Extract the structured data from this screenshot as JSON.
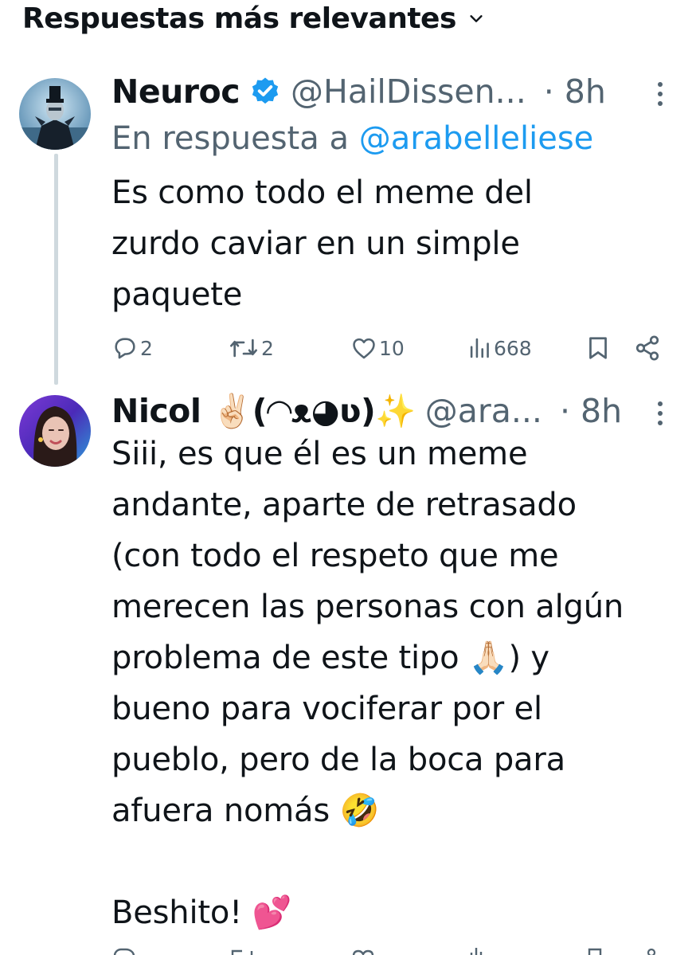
{
  "sort": {
    "label": "Respuestas más relevantes"
  },
  "tweets": [
    {
      "display_name": "Neuroc",
      "handle": "@HailDissen...",
      "time": "· 8h",
      "reply_prefix": "En respuesta a ",
      "reply_mention": "@arabelleliese",
      "text": "Es como todo el meme del\nzurdo caviar en un simple\npaquete",
      "replies": "2",
      "retweets": "2",
      "likes": "10",
      "views": "668"
    },
    {
      "display_name": "Nicol ✌🏻(◠ᴥ◕ʋ)✨",
      "handle": "@ara...",
      "time": "· 8h",
      "text": "Siii, es que él es un meme\nandante, aparte de retrasado\n(con todo el respeto que me\nmerecen las personas con algún\nproblema de este tipo 🙏🏻) y\nbueno para vociferar por el\npueblo, pero de la boca para\nafuera nomás 🤣\n\nBeshito! 💕"
    }
  ],
  "colors": {
    "accent": "#1d9bf0",
    "secondary_text": "#536471",
    "primary_text": "#0f1419",
    "thread_line": "#cfd9de"
  }
}
